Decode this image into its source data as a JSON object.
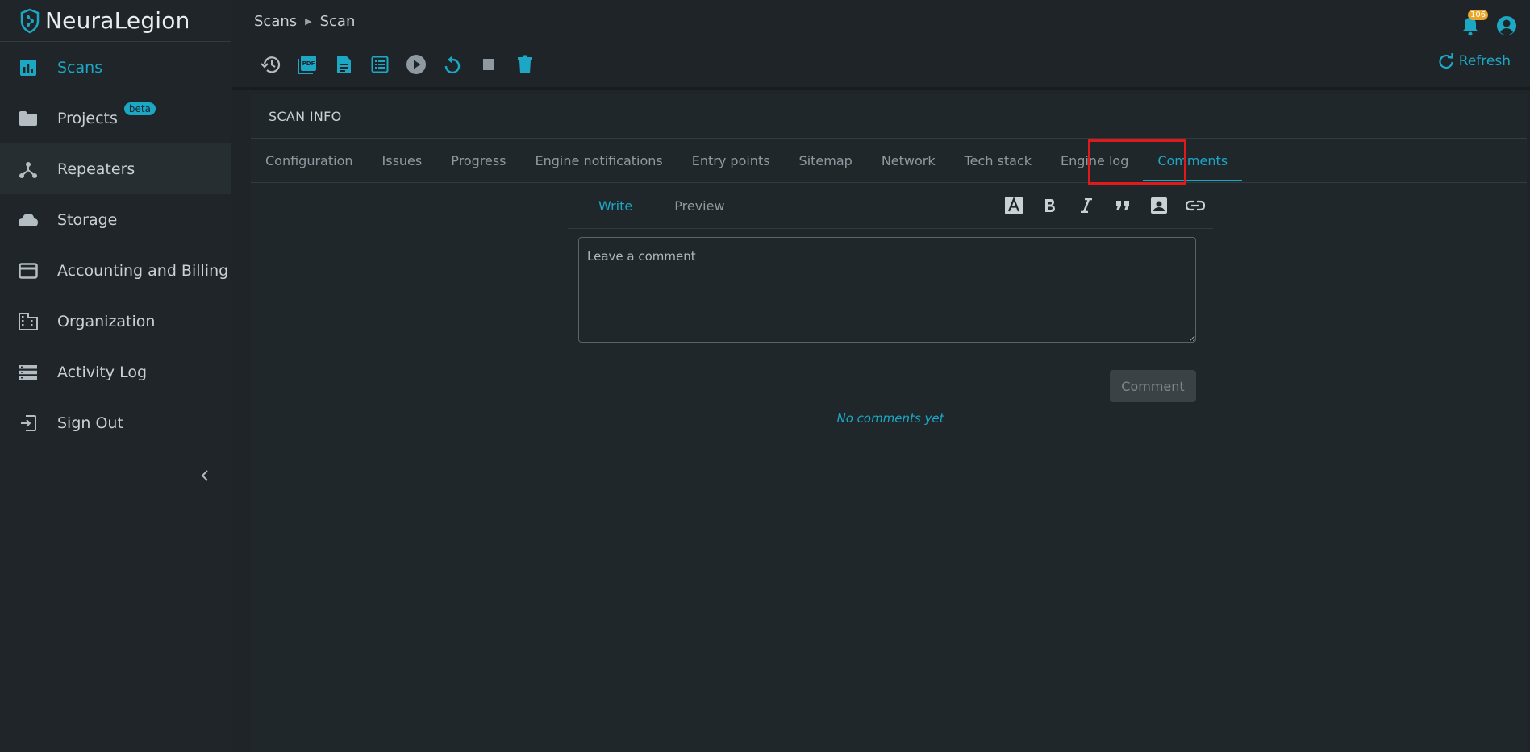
{
  "app": {
    "brand": "NeuraLegion"
  },
  "sidebar": {
    "items": [
      {
        "label": "Scans",
        "icon": "chart-icon"
      },
      {
        "label": "Projects",
        "icon": "folder-icon",
        "badge": "beta"
      },
      {
        "label": "Repeaters",
        "icon": "repeater-icon"
      },
      {
        "label": "Storage",
        "icon": "cloud-icon"
      },
      {
        "label": "Accounting and Billing",
        "icon": "credit-card-icon"
      },
      {
        "label": "Organization",
        "icon": "building-icon"
      },
      {
        "label": "Activity Log",
        "icon": "list-icon"
      },
      {
        "label": "Sign Out",
        "icon": "sign-out-icon"
      }
    ]
  },
  "header": {
    "breadcrumb": [
      "Scans",
      "Scan"
    ],
    "notifications_count": "106"
  },
  "toolbar": {
    "refresh_label": "Refresh"
  },
  "panel": {
    "title": "SCAN INFO",
    "tabs": [
      "Configuration",
      "Issues",
      "Progress",
      "Engine notifications",
      "Entry points",
      "Sitemap",
      "Network",
      "Tech stack",
      "Engine log",
      "Comments"
    ],
    "active_tab": "Comments"
  },
  "editor": {
    "write_label": "Write",
    "preview_label": "Preview",
    "placeholder": "Leave a comment",
    "submit_label": "Comment",
    "empty_text": "No comments yet"
  },
  "colors": {
    "accent": "#1ca7c5",
    "highlight": "#e2191b",
    "badge": "#e9a52c"
  }
}
